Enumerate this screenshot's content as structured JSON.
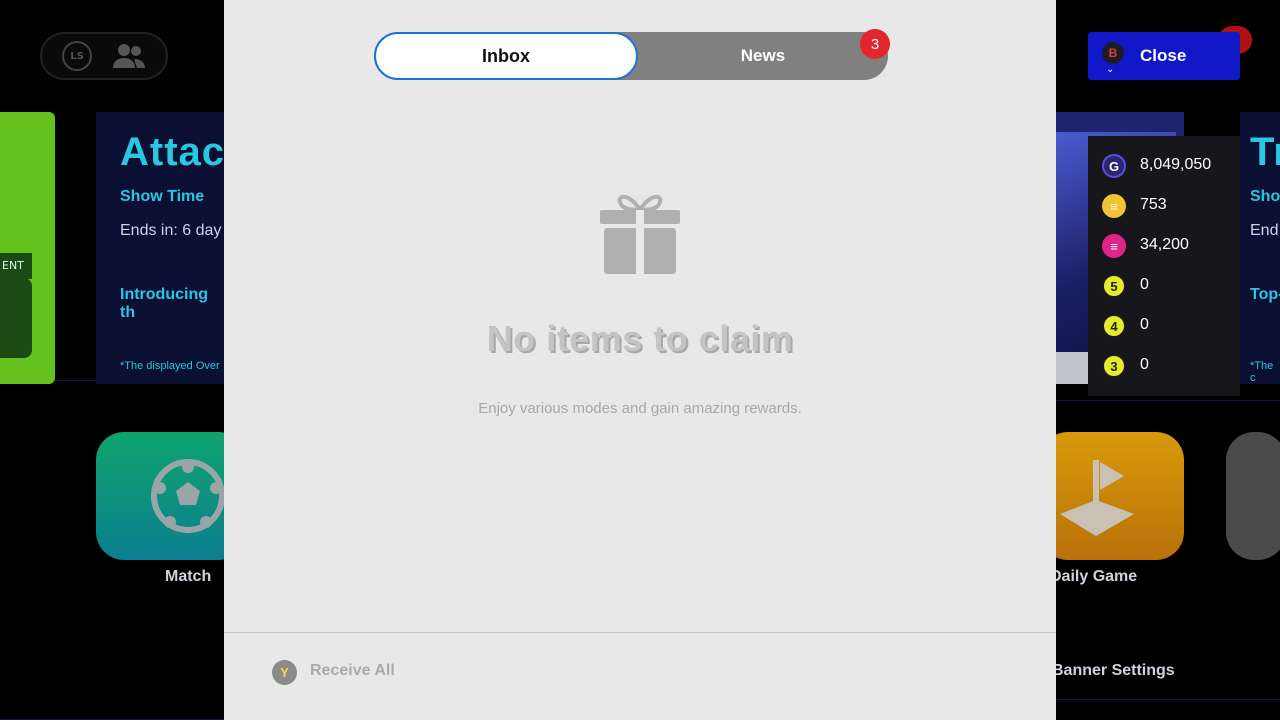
{
  "modal": {
    "tabs": [
      {
        "label": "Inbox",
        "active": true
      },
      {
        "label": "News",
        "active": false
      }
    ],
    "news_badge": "3",
    "empty_title": "No items to claim",
    "empty_subtitle": "Enjoy various modes and gain amazing rewards.",
    "receive_all_key": "Y",
    "receive_all_label": "Receive All"
  },
  "close_button": {
    "key": "B",
    "label": "Close"
  },
  "currencies": [
    {
      "icon": "gp-coin-icon",
      "glyph": "G",
      "value": "8,049,050",
      "color": "#5a4fe0"
    },
    {
      "icon": "efootball-coin-icon",
      "glyph": "≡",
      "value": "753",
      "color": "#f3c235"
    },
    {
      "icon": "efootball-points-icon",
      "glyph": "≡",
      "value": "34,200",
      "color": "#e0258a"
    },
    {
      "icon": "level-5-token-icon",
      "glyph": "5",
      "value": "0",
      "color": "#e6ec2a"
    },
    {
      "icon": "level-4-token-icon",
      "glyph": "4",
      "value": "0",
      "color": "#e6ec2a"
    },
    {
      "icon": "level-3-token-icon",
      "glyph": "3",
      "value": "0",
      "color": "#e6ec2a"
    }
  ],
  "background": {
    "left_card": {
      "title": "Attac",
      "subtitle": "Show Time",
      "ends": "Ends in: 6 day",
      "intro": "Introducing th",
      "note": "*The displayed Over"
    },
    "right_card": {
      "title": "Tr",
      "subtitle": "Sho",
      "ends": "End",
      "intro": "Top-",
      "note": "*The c"
    },
    "ent_tab": "ENT",
    "top_icon_ls": "LS",
    "modes": [
      {
        "label": "Match"
      },
      {
        "label": "Daily Game"
      }
    ],
    "banner_settings": "Banner Settings"
  }
}
